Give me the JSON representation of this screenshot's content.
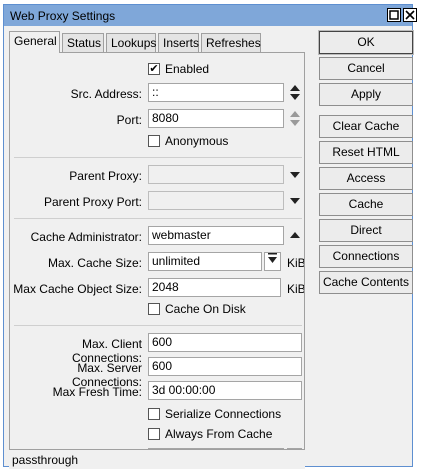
{
  "window": {
    "title": "Web Proxy Settings"
  },
  "tabs": [
    "General",
    "Status",
    "Lookups",
    "Inserts",
    "Refreshes"
  ],
  "general": {
    "enabled": {
      "label": "Enabled",
      "checked": true
    },
    "src_address": {
      "label": "Src. Address:",
      "value": "::"
    },
    "port": {
      "label": "Port:",
      "value": "8080"
    },
    "anonymous": {
      "label": "Anonymous",
      "checked": false
    },
    "parent_proxy": {
      "label": "Parent Proxy:",
      "value": ""
    },
    "parent_proxy_port": {
      "label": "Parent Proxy Port:",
      "value": ""
    },
    "cache_administrator": {
      "label": "Cache Administrator:",
      "value": "webmaster"
    },
    "max_cache_size": {
      "label": "Max. Cache Size:",
      "value": "unlimited",
      "unit": "KiB"
    },
    "max_cache_object_size": {
      "label": "Max Cache Object Size:",
      "value": "2048",
      "unit": "KiB"
    },
    "cache_on_disk": {
      "label": "Cache On Disk",
      "checked": false
    },
    "max_client_connections": {
      "label": "Max. Client Connections:",
      "value": "600"
    },
    "max_server_connections": {
      "label": "Max. Server Connections:",
      "value": "600"
    },
    "max_fresh_time": {
      "label": "Max Fresh Time:",
      "value": "3d 00:00:00"
    },
    "serialize_connections": {
      "label": "Serialize Connections",
      "checked": false
    },
    "always_from_cache": {
      "label": "Always From Cache",
      "checked": false
    }
  },
  "buttons": {
    "ok": "OK",
    "cancel": "Cancel",
    "apply": "Apply",
    "clear_cache": "Clear Cache",
    "reset_html": "Reset HTML",
    "access": "Access",
    "cache": "Cache",
    "direct": "Direct",
    "connections": "Connections",
    "cache_contents": "Cache Contents"
  },
  "status_bar": {
    "text": "passthrough"
  }
}
